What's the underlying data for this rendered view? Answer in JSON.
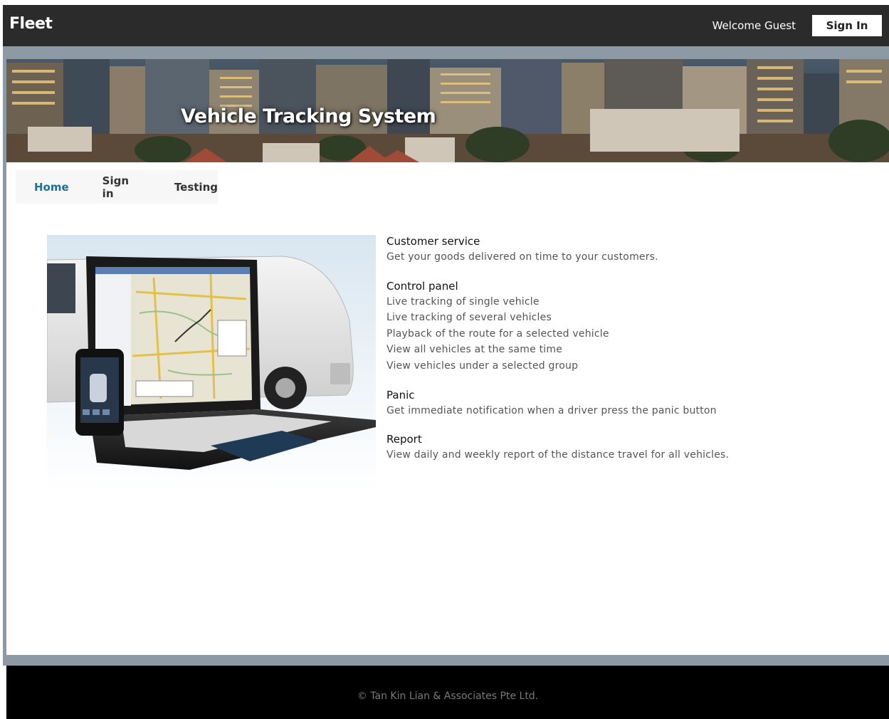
{
  "header": {
    "brand": "Fleet",
    "welcome": "Welcome Guest",
    "signin_label": "Sign In"
  },
  "banner": {
    "title": "Vehicle Tracking System"
  },
  "nav": {
    "items": [
      {
        "label": "Home",
        "active": true
      },
      {
        "label": "Sign in",
        "active": false
      },
      {
        "label": "Testing",
        "active": false
      }
    ]
  },
  "features": [
    {
      "title": "Customer service",
      "lines": [
        "Get your goods delivered on time to your customers."
      ]
    },
    {
      "title": "Control panel",
      "lines": [
        "Live tracking of single vehicle",
        "Live tracking of several vehicles",
        "Playback of the route for a selected vehicle",
        "View all vehicles at the same time",
        "View vehicles under a selected group"
      ]
    },
    {
      "title": "Panic",
      "lines": [
        "Get immediate notification when a driver press the panic button"
      ]
    },
    {
      "title": "Report",
      "lines": [
        "View daily and weekly report of the distance travel for all vehicles."
      ]
    }
  ],
  "footer": {
    "copyright": "© Tan Kin Lian & Associates Pte Ltd."
  },
  "colors": {
    "topbar": "#2b2b2b",
    "surround": "#8e9aa3",
    "nav_active": "#1d6d99",
    "footer": "#000000"
  }
}
